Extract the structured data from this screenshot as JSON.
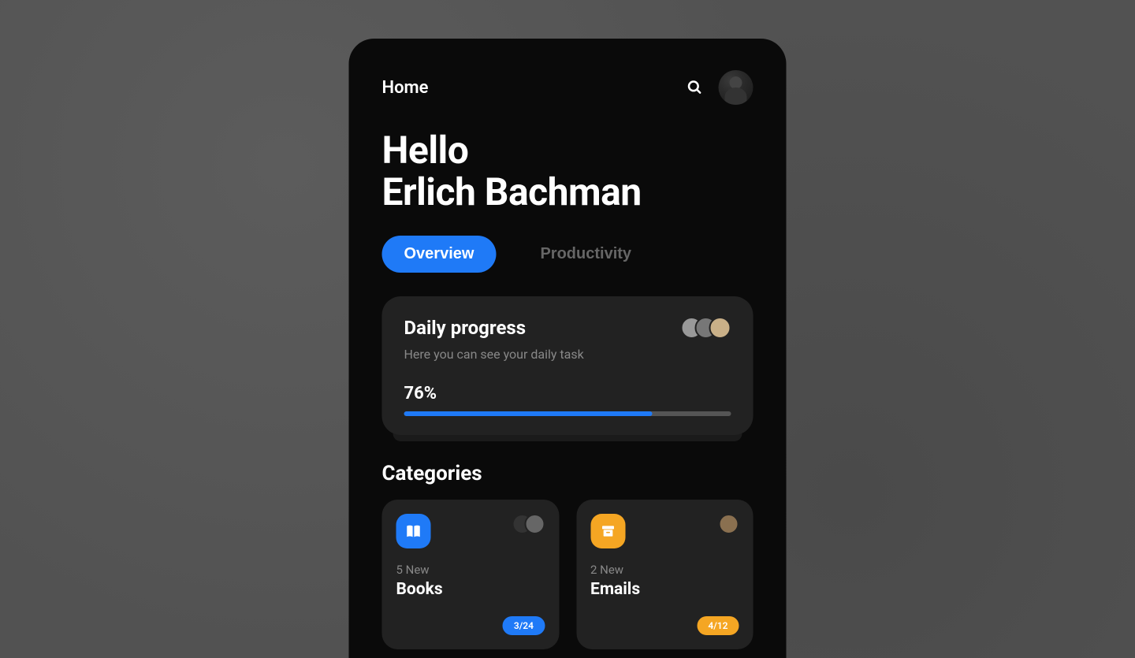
{
  "topbar": {
    "title": "Home"
  },
  "greeting": {
    "line1": "Hello",
    "line2": "Erlich Bachman"
  },
  "tabs": {
    "overview": "Overview",
    "productivity": "Productivity"
  },
  "progress_card": {
    "title": "Daily progress",
    "subtitle": "Here you can see your daily task",
    "percent_label": "76%",
    "percent_value": 76
  },
  "categories": {
    "section_title": "Categories",
    "items": [
      {
        "new_label": "5 New",
        "title": "Books",
        "badge": "3/24",
        "color": "blue",
        "icon": "book"
      },
      {
        "new_label": "2 New",
        "title": "Emails",
        "badge": "4/12",
        "color": "orange",
        "icon": "archive"
      }
    ]
  },
  "colors": {
    "accent_blue": "#1f7af7",
    "accent_orange": "#f5a623",
    "bg_dark": "#0a0a0a",
    "card_bg": "#222"
  }
}
